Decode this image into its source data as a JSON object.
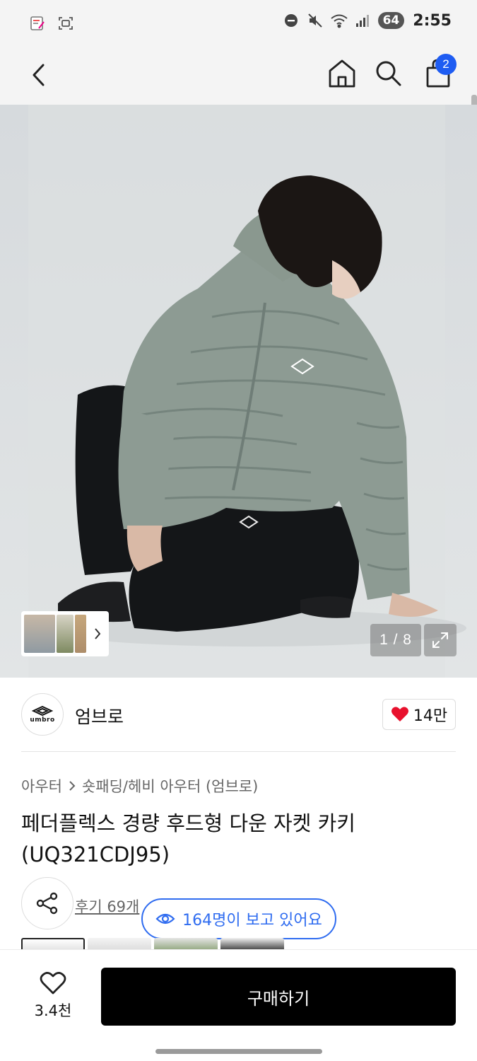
{
  "status_bar": {
    "time": "2:55",
    "battery": "64"
  },
  "app_bar": {
    "cart_count": "2"
  },
  "gallery": {
    "page_counter": "1 / 8"
  },
  "brand": {
    "name": "엄브로",
    "logo_text": "umbro",
    "like_count": "14만"
  },
  "breadcrumb": {
    "category": "아우터",
    "subcategory": "숏패딩/헤비 아우터 (엄브로)"
  },
  "product": {
    "title": "페더플렉스 경량 후드형 다운 자켓 카키(UQ321CDJ95)"
  },
  "review": {
    "label": "후기 69개"
  },
  "viewers": {
    "label": "164명이 보고 있어요"
  },
  "bottom_bar": {
    "wishlist_count": "3.4천",
    "buy_label": "구매하기"
  },
  "colors": {
    "accent": "#2f6cf0",
    "badge": "#1e5cf2",
    "heart": "#e8112d",
    "buy_button": "#000000"
  }
}
